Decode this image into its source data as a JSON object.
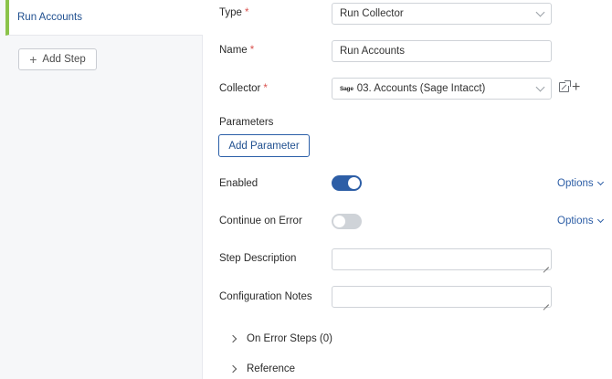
{
  "sidebar": {
    "steps": [
      {
        "label": "Run Accounts"
      }
    ],
    "add_step_label": "Add Step"
  },
  "form": {
    "type": {
      "label": "Type",
      "value": "Run Collector"
    },
    "name": {
      "label": "Name",
      "value": "Run Accounts"
    },
    "collector": {
      "label": "Collector",
      "logo_text": "Sage",
      "value": "03. Accounts (Sage Intacct)"
    },
    "parameters": {
      "label": "Parameters",
      "button_label": "Add Parameter"
    },
    "enabled": {
      "label": "Enabled",
      "on": true,
      "options_label": "Options"
    },
    "continue_on_error": {
      "label": "Continue on Error",
      "on": false,
      "options_label": "Options"
    },
    "step_description": {
      "label": "Step Description",
      "value": ""
    },
    "configuration_notes": {
      "label": "Configuration Notes",
      "value": ""
    },
    "on_error_steps": {
      "label": "On Error Steps (0)"
    },
    "reference": {
      "label": "Reference"
    }
  },
  "colors": {
    "accent": "#2d5ea6",
    "active_step_bar": "#8bc34a",
    "required": "#d9534f"
  }
}
